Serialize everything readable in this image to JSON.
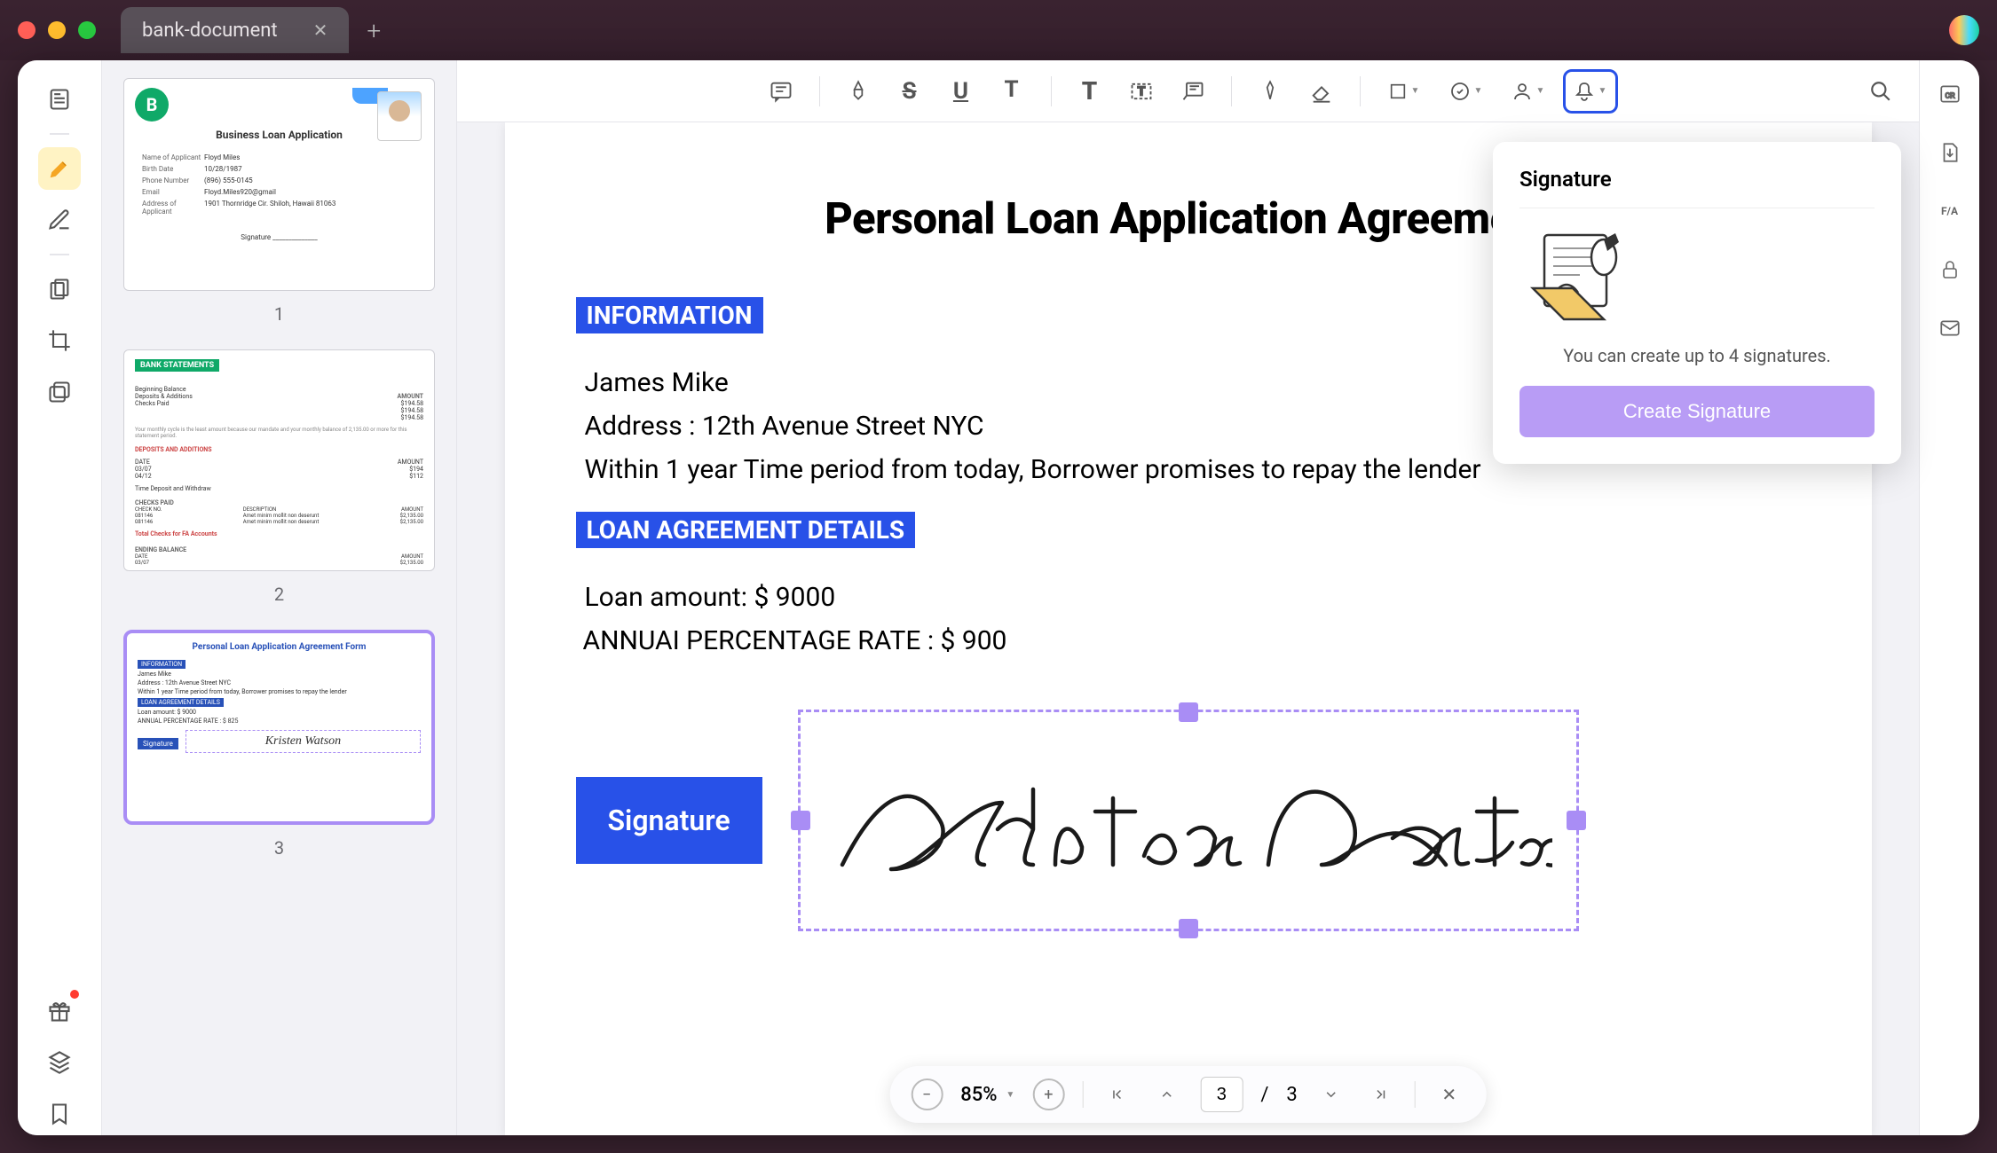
{
  "window": {
    "tab_title": "bank-document"
  },
  "toolbar": {
    "signature_tooltip": "Signature"
  },
  "thumbnails": {
    "page1": {
      "num": "1",
      "title": "Business Loan Application",
      "logo_letter": "B",
      "rows": [
        {
          "label": "Name of Applicant",
          "value": "Floyd Miles"
        },
        {
          "label": "Birth Date",
          "value": "10/28/1987"
        },
        {
          "label": "Phone Number",
          "value": "(896) 555-0145"
        },
        {
          "label": "Email",
          "value": "Floyd.Miles920@gmail"
        },
        {
          "label": "Address of Applicant",
          "value": "1901 Thornridge Cir. Shiloh, Hawaii 81063"
        }
      ],
      "sig_label": "Signature"
    },
    "page2": {
      "num": "2",
      "header": "BANK STATEMENTS",
      "amount_label": "AMOUNT",
      "sections": [
        "Beginning Balance",
        "Deposits & Additions",
        "Checks Paid",
        "Time Deposit and Withdraw"
      ],
      "ending": "ENDING BALANCE"
    },
    "page3": {
      "num": "3",
      "title": "Personal Loan Application Agreement Form",
      "tag_info": "INFORMATION",
      "name": "James Mike",
      "addr": "Address : 12th Avenue Street NYC",
      "within": "Within 1 year Time period from today, Borrower promises to repay the lender",
      "tag_loan": "LOAN AGREEMENT DETAILS",
      "amount": "Loan amount: $ 9000",
      "apr": "ANNUAL PERCENTAGE RATE : $ 825",
      "sig": "Kristen Watson",
      "siglabel": "Signature"
    }
  },
  "document": {
    "title": "Personal Loan Application Agreement",
    "section_info": "INFORMATION",
    "name": "James Mike",
    "address": "Address : 12th Avenue Street NYC",
    "terms": "Within 1 year Time period from today, Borrower promises to repay the lender",
    "section_loan": "LOAN AGREEMENT DETAILS",
    "loan_amount": "Loan amount: $ 9000",
    "apr": "ANNUAI PERCENTAGE RATE : $ 900",
    "sig_label": "Signature",
    "sig_name": "Kristen Watson"
  },
  "popup": {
    "title": "Signature",
    "text": "You can create up to 4 signatures.",
    "button": "Create Signature"
  },
  "bottombar": {
    "zoom": "85%",
    "current_page": "3",
    "total_pages": "3",
    "sep": "/"
  }
}
